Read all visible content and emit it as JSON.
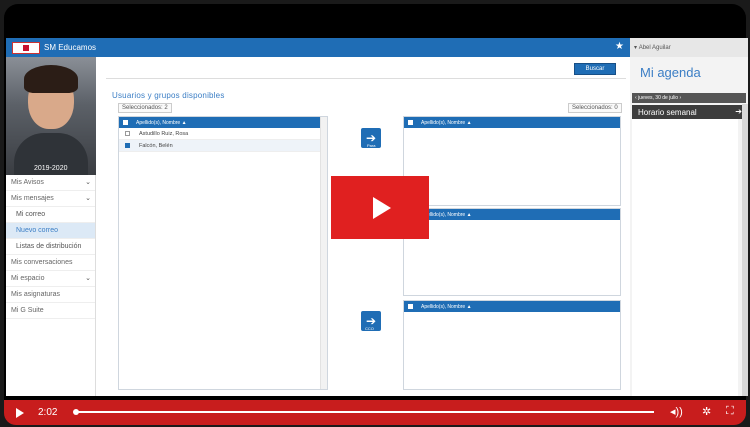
{
  "topbar": {
    "app_name": "SM Educamos"
  },
  "sidebar": {
    "year": "2019-2020",
    "items": [
      {
        "label": "Mis Avisos",
        "chev": "⌄"
      },
      {
        "label": "Mis mensajes",
        "chev": "⌄"
      },
      {
        "label": "Mi correo",
        "sub": true
      },
      {
        "label": "Nuevo correo",
        "sub": true,
        "active": true
      },
      {
        "label": "Listas de distribución",
        "sub": true
      },
      {
        "label": "Mis conversaciones"
      },
      {
        "label": "Mi espacio",
        "chev": "⌄"
      },
      {
        "label": "Mis asignaturas"
      },
      {
        "label": "Mi G Suite"
      }
    ]
  },
  "main": {
    "search_button": "Buscar",
    "section_title": "Usuarios y grupos disponibles",
    "selected_left": "Seleccionados: 2",
    "selected_right": "Seleccionados: 0",
    "column_header": "Apellido(s), Nombre",
    "rows": [
      {
        "name": "Astudillo Ruiz, Rosa",
        "checked": false
      },
      {
        "name": "Falcón, Belén",
        "checked": true
      }
    ],
    "button_to_label": "Para",
    "button_bcc_label": "CCO"
  },
  "agenda": {
    "user": "Abel Aguilar",
    "title": "Mi agenda",
    "date": "jueves, 30 de julio",
    "weekly": "Horario semanal"
  },
  "video": {
    "time": "2:02",
    "progress": 0
  }
}
